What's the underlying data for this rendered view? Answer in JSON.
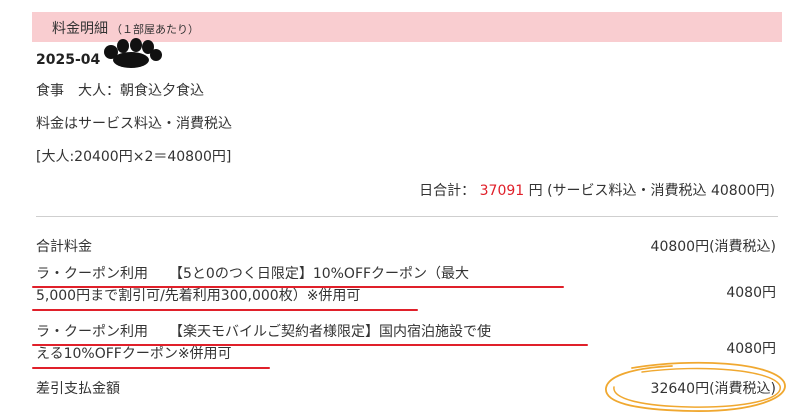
{
  "header": {
    "title": "料金明細",
    "subtitle": "（１部屋あたり）"
  },
  "date": "2025-04",
  "meal": "食事　大人：朝食込夕食込",
  "fee_note": "料金はサービス料込・消費税込",
  "breakdown": "[大人:20400円×2＝40800円]",
  "daily": {
    "label": "日合計：",
    "amount": "37091",
    "suffix": "円 (サービス料込・消費税込 40800円)"
  },
  "total": {
    "label": "合計料金",
    "value": "40800円(消費税込)"
  },
  "coupons": [
    {
      "line1": "ラ・クーポン利用　　【5と0のつく日限定】10%OFFクーポン（最大",
      "line2": "5,000円まで割引可/先着利用300,000枚）※併用可",
      "amount": "4080",
      "unit": "円"
    },
    {
      "line1": "ラ・クーポン利用　　【楽天モバイルご契約者様限定】国内宿泊施設で使",
      "line2": "える10%OFFクーポン※併用可",
      "amount": "4080",
      "unit": "円"
    }
  ],
  "payment": {
    "label": "差引支払金額",
    "value": "32640円(消費税込)"
  },
  "colors": {
    "header_bg": "#f9cdd0",
    "accent_red": "#e0202a",
    "annotation_orange": "#f0a830"
  }
}
